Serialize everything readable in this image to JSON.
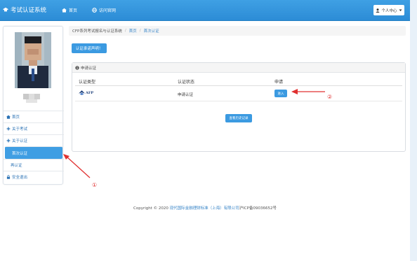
{
  "app": {
    "title": "考试认证系统"
  },
  "nav": {
    "home": "首页",
    "visit_site": "访问官网"
  },
  "user_menu": {
    "label": "个人中心"
  },
  "sidebar": {
    "items": [
      {
        "label": "首页"
      },
      {
        "label": "关于考试"
      },
      {
        "label": "关于认证"
      },
      {
        "label": "首次认证"
      },
      {
        "label": "再认证"
      },
      {
        "label": "安全退出"
      }
    ]
  },
  "breadcrumb": {
    "root": "CFP系列考试报名与认证系统",
    "home": "首页",
    "current": "首次认证"
  },
  "notice_button": "认证承诺声明！",
  "panel": {
    "title": "申请认证",
    "columns": [
      "认证类型",
      "认证状态",
      "申请"
    ],
    "row": {
      "logo_text": "AFP",
      "status": "申请认证",
      "action": "进入"
    },
    "history_button": "查看历史记录"
  },
  "footer": {
    "prefix": "Copyright © 2020 ",
    "company": "现代国际金融理财标准（上海）有限公司",
    "icp": "沪ICP备09036652号"
  },
  "annotations": {
    "one": "①",
    "two": "②"
  },
  "colors": {
    "navbar": "#2c8cd6",
    "accent": "#3b9ae1",
    "annotation": "#e03030"
  }
}
